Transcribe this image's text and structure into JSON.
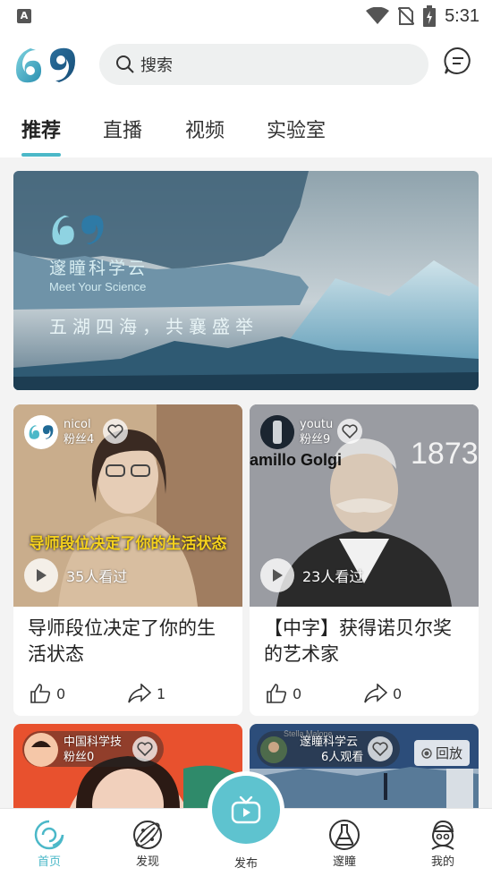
{
  "status_bar": {
    "time": "5:31",
    "notif_icon_letter": "A"
  },
  "header": {
    "search_placeholder": "搜索"
  },
  "tabs": [
    {
      "label": "推荐",
      "active": true
    },
    {
      "label": "直播"
    },
    {
      "label": "视频"
    },
    {
      "label": "实验室"
    }
  ],
  "banner": {
    "title": "邃瞳科学云",
    "subtitle": "Meet Your Science",
    "slogan": "五湖四海，共襄盛举"
  },
  "cards": [
    {
      "author": "nicol",
      "fans": "粉丝4",
      "views": "35人看过",
      "caption": "导师段位决定了你的生活状态",
      "title": "导师段位决定了你的生活状态",
      "likes": "0",
      "shares": "1"
    },
    {
      "author": "youtu",
      "fans": "粉丝9",
      "views": "23人看过",
      "image_text_1": "1873",
      "image_text_2": "amillo Golgi",
      "title": "【中字】获得诺贝尔奖的艺术家",
      "likes": "0",
      "shares": "0"
    },
    {
      "author": "中国科学技",
      "fans": "粉丝0"
    },
    {
      "author": "邃瞳科学云",
      "fans": "6人观看",
      "replay": "回放",
      "tiny_name": "Stella Malone"
    }
  ],
  "bottom_nav": [
    {
      "label": "首页",
      "icon": "home-icon",
      "active": true
    },
    {
      "label": "发现",
      "icon": "discover-icon"
    },
    {
      "label": "发布",
      "icon": "tv-icon"
    },
    {
      "label": "邃瞳",
      "icon": "flask-icon"
    },
    {
      "label": "我的",
      "icon": "profile-icon"
    }
  ],
  "colors": {
    "accent": "#4bb8c8",
    "publish": "#5ec3cf",
    "caption": "#f6d21d"
  }
}
